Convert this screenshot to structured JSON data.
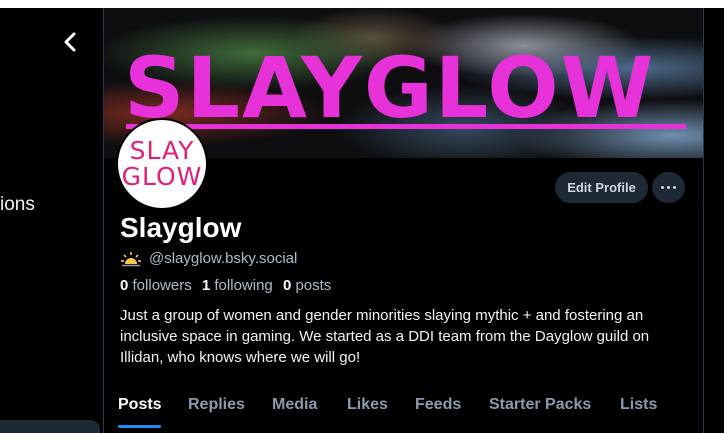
{
  "banner": {
    "text": "SLAYGLOW"
  },
  "avatar": {
    "line1": "SLAY",
    "line2": "GLOW"
  },
  "nav": {
    "partial_label": "ions"
  },
  "profile": {
    "display_name": "Slayglow",
    "handle": "@slayglow.bsky.social",
    "followers_count": "0",
    "followers_label": "followers",
    "following_count": "1",
    "following_label": "following",
    "posts_count": "0",
    "posts_label": "posts",
    "bio": "Just a group of women and gender minorities slaying mythic + and fostering an inclusive space in gaming. We started as a DDI team from the Dayglow guild on Illidan, who knows where we will go!"
  },
  "actions": {
    "edit_profile": "Edit Profile"
  },
  "tabs": [
    {
      "label": "Posts"
    },
    {
      "label": "Replies"
    },
    {
      "label": "Media"
    },
    {
      "label": "Likes"
    },
    {
      "label": "Feeds"
    },
    {
      "label": "Starter Packs"
    },
    {
      "label": "Lists"
    }
  ],
  "colors": {
    "accent": "#208bfe",
    "banner_text": "#e632d8",
    "avatar_text": "#e0207a"
  },
  "icons": {
    "back": "chevron-left-icon",
    "more": "ellipsis-icon",
    "handle": "sun-icon"
  }
}
